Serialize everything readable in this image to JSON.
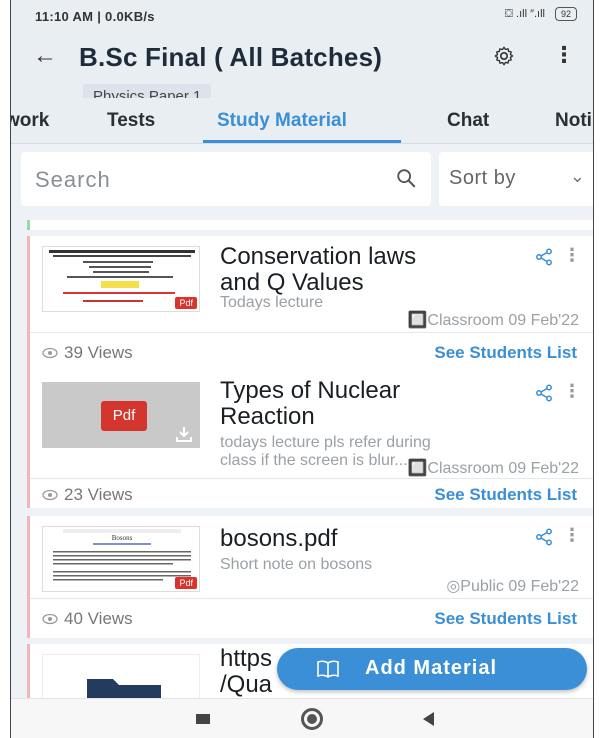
{
  "status_bar": {
    "time_speed": "11:10 AM | 0.0KB/s",
    "signal_text": "⛋ .ıll  ″.ıll",
    "battery": "92"
  },
  "header": {
    "title": "B.Sc Final ( All Batches)",
    "subtitle": "Physics Paper 1"
  },
  "tabs": [
    {
      "label": "work"
    },
    {
      "label": "Tests"
    },
    {
      "label": "Study Material",
      "active": true
    },
    {
      "label": "Chat"
    },
    {
      "label": "Noti"
    }
  ],
  "search": {
    "placeholder": "Search",
    "sort_label": "Sort by"
  },
  "materials": [
    {
      "title_line1": "Conservation laws",
      "title_line2": "and Q Values",
      "description": "Todays lecture",
      "meta": "🔲Classroom  09 Feb'22",
      "views": "39 Views",
      "link": "See Students List",
      "badge": "Pdf"
    },
    {
      "title_line1": "Types of Nuclear",
      "title_line2": "Reaction",
      "description_line1": "todays lecture pls refer during",
      "description_line2": "class if the screen is blur....",
      "meta": "🔲Classroom  09 Feb'22",
      "views": "23 Views",
      "link": "See Students List",
      "badge": "Pdf"
    },
    {
      "title_line1": "bosons.pdf",
      "description": "Short note on bosons",
      "meta": "◎Public  09 Feb'22",
      "views": "40 Views",
      "link": "See Students List",
      "badge": "Pdf",
      "thumb_heading": "Bosons"
    },
    {
      "title_line1": "https",
      "title_line2": "/Qua"
    }
  ],
  "fab": {
    "label": "Add Material"
  },
  "colors": {
    "accent": "#3a8fd6",
    "pdf_red": "#d4362d",
    "header_bg": "#e9eef3"
  }
}
